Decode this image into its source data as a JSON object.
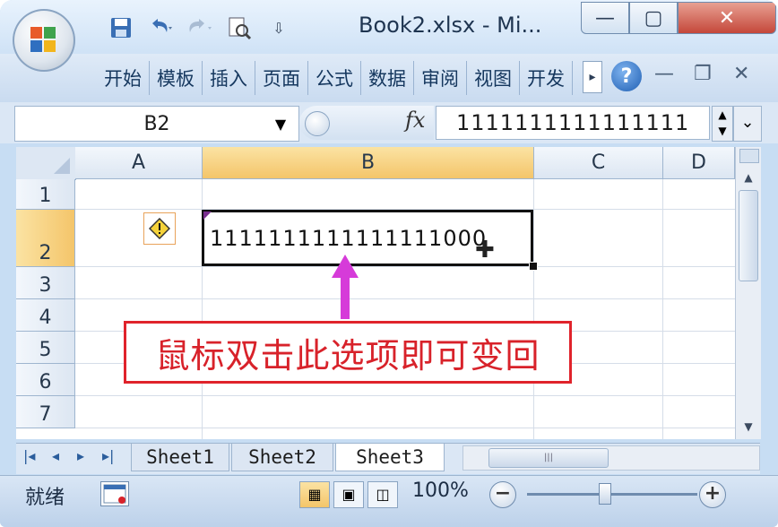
{
  "window": {
    "title": "Book2.xlsx  -  Mi...",
    "min_glyph": "—",
    "max_glyph": "▢",
    "close_glyph": "✕"
  },
  "ribbon": {
    "tabs": [
      "开始",
      "模板",
      "插入",
      "页面",
      "公式",
      "数据",
      "审阅",
      "视图",
      "开发"
    ],
    "scroll_glyph": "▸",
    "help_glyph": "?",
    "rib_min": "—",
    "rib_restore": "❐",
    "rib_close": "✕"
  },
  "formula_bar": {
    "name_box": "B2",
    "dropdown_glyph": "▼",
    "fx_label": "fx",
    "value": "1111111111111111",
    "expand_glyph": "⌄"
  },
  "grid": {
    "columns": [
      "A",
      "B",
      "C",
      "D"
    ],
    "selected_column": "B",
    "rows": [
      "1",
      "2",
      "3",
      "4",
      "5",
      "6",
      "7"
    ],
    "selected_row": "2",
    "active_cell_value": "1111111111111111000",
    "warn_glyph": "!"
  },
  "annotation": {
    "text": "鼠标双击此选项即可变回",
    "color": "#d8222a",
    "arrow_color": "#d63bd9"
  },
  "sheets": {
    "tabs": [
      "Sheet1",
      "Sheet2",
      "Sheet3"
    ],
    "active": "Sheet3",
    "nav": [
      "|◂",
      "◂",
      "▸",
      "▸|"
    ]
  },
  "status": {
    "ready": "就绪",
    "zoom": "100%",
    "zoom_minus": "−",
    "zoom_plus": "+"
  }
}
